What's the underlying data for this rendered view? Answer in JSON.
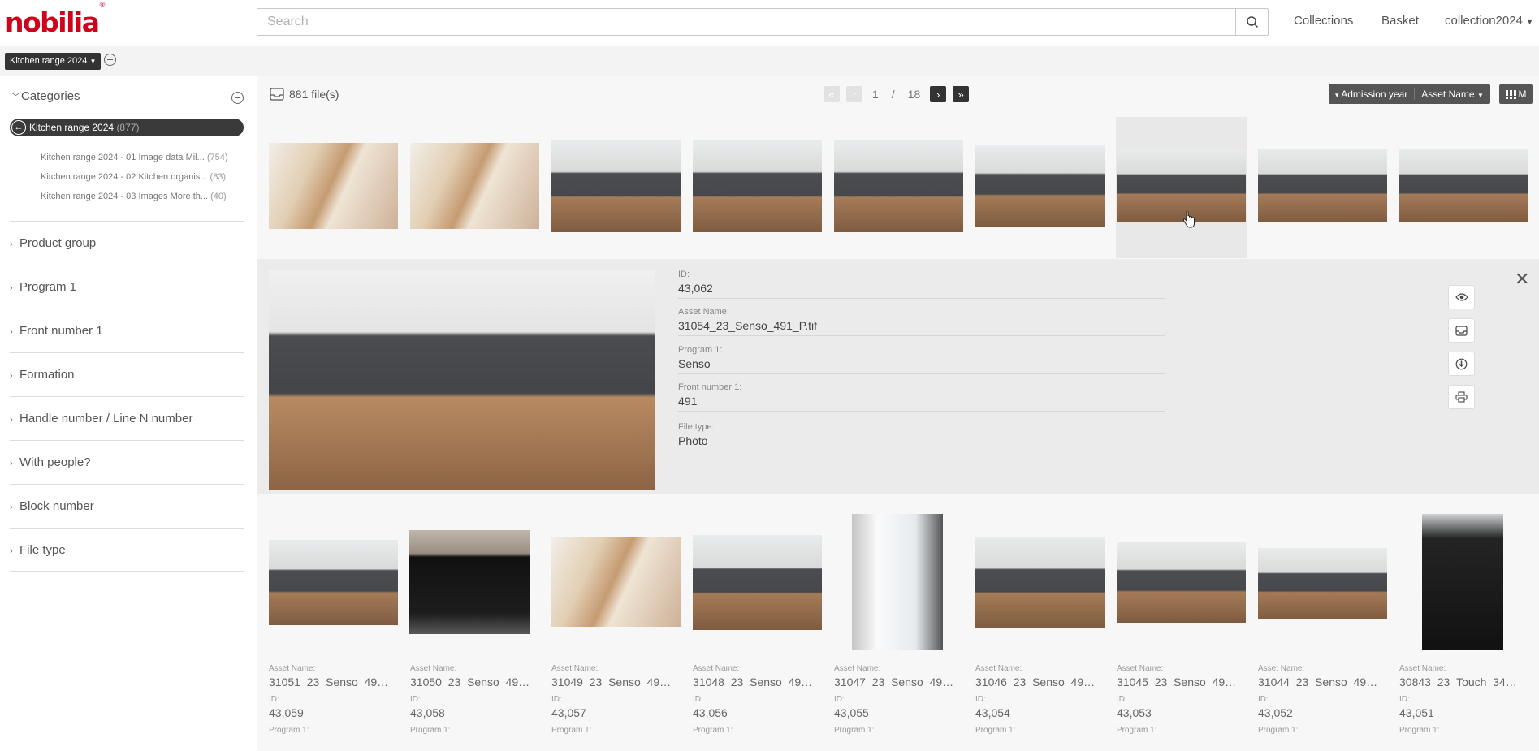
{
  "header": {
    "logo_text": "nobilia",
    "logo_mark": "®",
    "search_placeholder": "Search",
    "nav": {
      "collections": "Collections",
      "basket": "Basket",
      "account": "collection2024"
    }
  },
  "subbar": {
    "range_label": "Kitchen range 2024"
  },
  "sidebar": {
    "categories_title": "Categories",
    "active": {
      "label": "Kitchen range 2024",
      "count": "(877)"
    },
    "subcategories": [
      {
        "label": "Kitchen range 2024 - 01 Image data Mil...",
        "count": "(754)"
      },
      {
        "label": "Kitchen range 2024 - 02 Kitchen organis...",
        "count": "(83)"
      },
      {
        "label": "Kitchen range 2024 - 03 Images More th...",
        "count": "(40)"
      }
    ],
    "facets": [
      "Product group",
      "Program 1",
      "Front number 1",
      "Formation",
      "Handle number / Line N number",
      "With people?",
      "Block number",
      "File type"
    ]
  },
  "toolbar": {
    "file_count": "881 file(s)",
    "page_current": "1",
    "page_sep": "/",
    "page_total": "18",
    "sort_order_label": "Admission year",
    "sort_field_label": "Asset Name",
    "view_label": "M"
  },
  "detail": {
    "fields": [
      {
        "label": "ID:",
        "value": "43,062"
      },
      {
        "label": "Asset Name:",
        "value": "31054_23_Senso_491_P.tif"
      },
      {
        "label": "Program 1:",
        "value": "Senso"
      },
      {
        "label": "Front number 1:",
        "value": "491"
      },
      {
        "label": "File type:",
        "value": "Photo"
      }
    ]
  },
  "grid_bottom": {
    "asset_label": "Asset Name:",
    "id_label": "ID:",
    "program_label": "Program 1:",
    "items": [
      {
        "name": "31051_23_Senso_491_...",
        "id": "43,059"
      },
      {
        "name": "31050_23_Senso_491_...",
        "id": "43,058"
      },
      {
        "name": "31049_23_Senso_491_...",
        "id": "43,057"
      },
      {
        "name": "31048_23_Senso_491_...",
        "id": "43,056"
      },
      {
        "name": "31047_23_Senso_491_...",
        "id": "43,055"
      },
      {
        "name": "31046_23_Senso_491_...",
        "id": "43,054"
      },
      {
        "name": "31045_23_Senso_491_...",
        "id": "43,053"
      },
      {
        "name": "31044_23_Senso_491_...",
        "id": "43,052"
      },
      {
        "name": "30843_23_Touch_340_...",
        "id": "43,051"
      }
    ]
  }
}
